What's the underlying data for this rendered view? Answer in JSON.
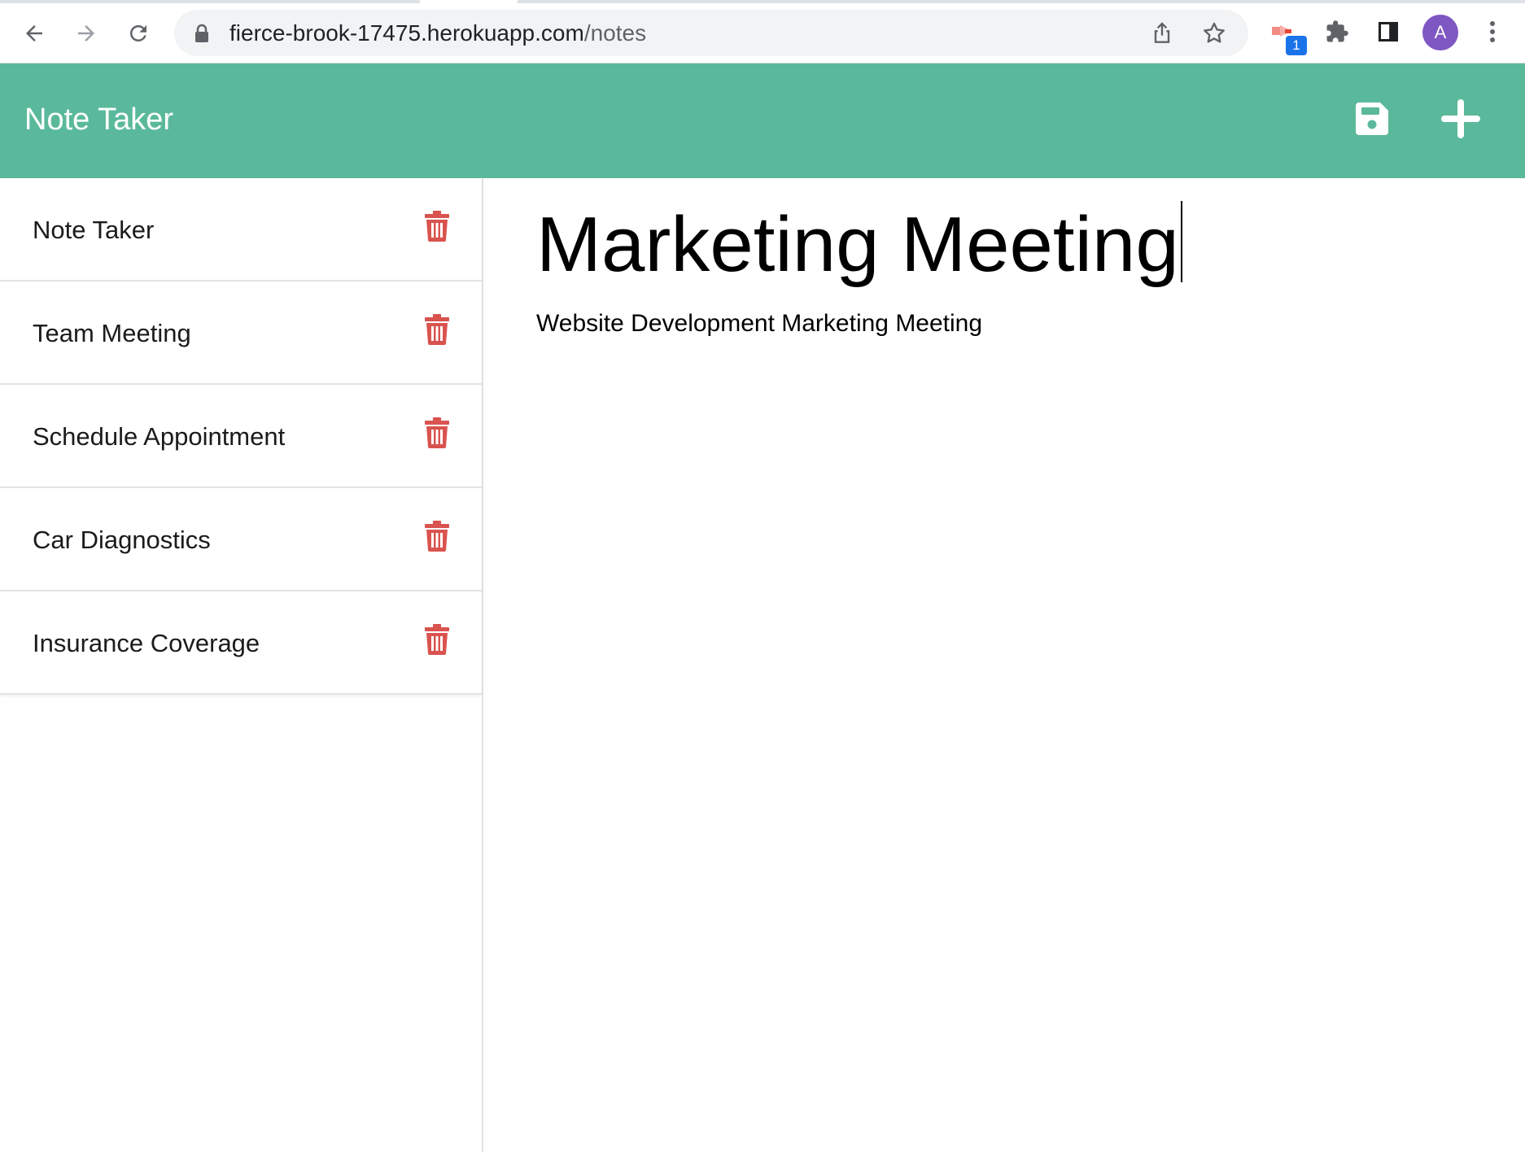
{
  "browser": {
    "url_host": "fierce-brook-17475.herokuapp.com",
    "url_path": "/notes",
    "extension_badge": "1",
    "profile_initial": "A",
    "icons": [
      "back-icon",
      "forward-icon",
      "reload-icon",
      "lock-icon",
      "share-icon",
      "star-icon",
      "extension-icon",
      "puzzle-icon",
      "side-panel-icon",
      "more-vert-icon"
    ]
  },
  "header": {
    "title": "Note Taker",
    "save_icon": "save-icon",
    "new_icon": "plus-icon",
    "color": "#5bb99b"
  },
  "notes": [
    {
      "title": "Note Taker"
    },
    {
      "title": "Team Meeting"
    },
    {
      "title": "Schedule Appointment"
    },
    {
      "title": "Car Diagnostics"
    },
    {
      "title": "Insurance Coverage"
    }
  ],
  "delete_icon_color": "#d9534f",
  "editor": {
    "title": "Marketing Meeting",
    "body": "Website Development Marketing Meeting"
  }
}
